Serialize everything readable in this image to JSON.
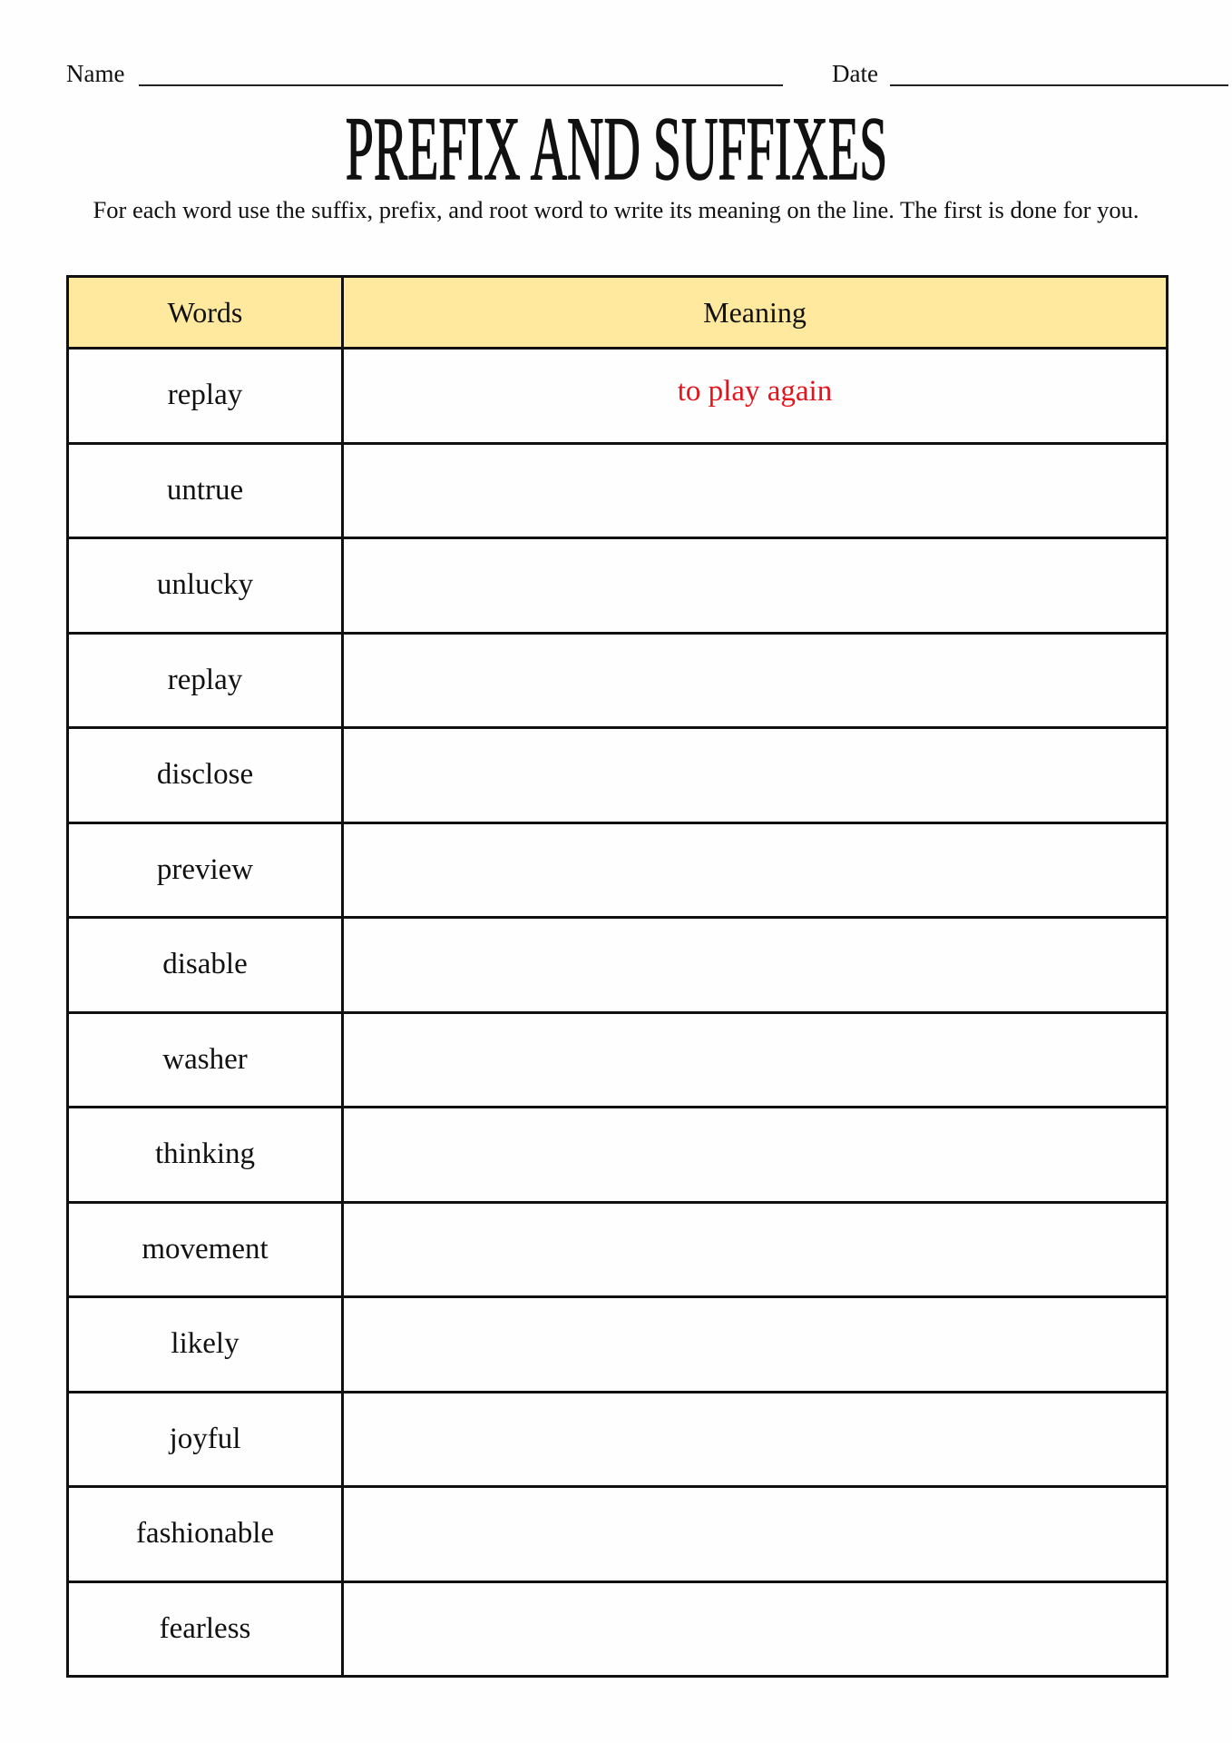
{
  "header": {
    "name_label": "Name",
    "date_label": "Date"
  },
  "title": "PREFIX AND SUFFIXES",
  "instructions": "For each word use the suffix, prefix, and root word to write its meaning on the line. The first is done for you.",
  "table": {
    "columns": [
      "Words",
      "Meaning"
    ],
    "header_color": "#fee99e",
    "answer_color": "#e3141c",
    "rows": [
      {
        "word": "replay",
        "meaning": "to play again"
      },
      {
        "word": "untrue",
        "meaning": ""
      },
      {
        "word": "unlucky",
        "meaning": ""
      },
      {
        "word": "replay",
        "meaning": ""
      },
      {
        "word": "disclose",
        "meaning": ""
      },
      {
        "word": "preview",
        "meaning": ""
      },
      {
        "word": "disable",
        "meaning": ""
      },
      {
        "word": "washer",
        "meaning": ""
      },
      {
        "word": "thinking",
        "meaning": ""
      },
      {
        "word": "movement",
        "meaning": ""
      },
      {
        "word": "likely",
        "meaning": ""
      },
      {
        "word": "joyful",
        "meaning": ""
      },
      {
        "word": "fashionable",
        "meaning": ""
      },
      {
        "word": "fearless",
        "meaning": ""
      }
    ]
  }
}
